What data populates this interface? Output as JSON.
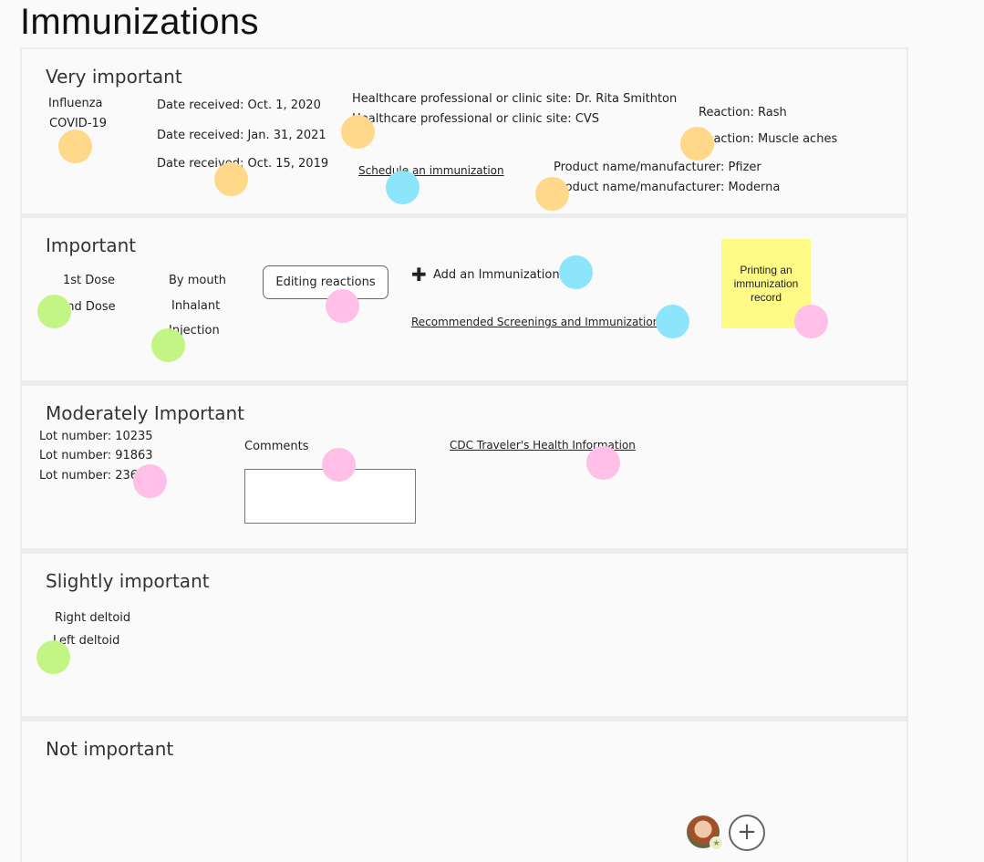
{
  "page": {
    "title": "Immunizations"
  },
  "sections": {
    "very_important": {
      "title": "Very important",
      "vaccine_1": "Influenza",
      "vaccine_2": "COVID-19",
      "date_1": "Date received: Oct. 1, 2020",
      "date_2": "Date received: Jan. 31, 2021",
      "date_3": "Date received: Oct. 15, 2019",
      "site_1": "Healthcare professional or clinic site: Dr. Rita Smithton",
      "site_2": "Healthcare professional or clinic site: CVS",
      "schedule_link": "Schedule an immunization",
      "reaction_1": "Reaction: Rash",
      "reaction_2": "Reaction: Muscle aches",
      "product_1": "Product name/manufacturer: Pfizer",
      "product_2": "Product name/manufacturer: Moderna"
    },
    "important": {
      "title": "Important",
      "dose_1": "1st Dose",
      "dose_2": "2nd Dose",
      "route_1": "By mouth",
      "route_2": "Inhalant",
      "route_3": "Injection",
      "editing_button": "Editing reactions",
      "add_label": "Add an Immunization",
      "recommended_link": "Recommended Screenings and Immunization",
      "sticky_note": "Printing an immunization record"
    },
    "moderately_important": {
      "title": "Moderately Important",
      "lot_1": "Lot number: 10235",
      "lot_2": "Lot number: 91863",
      "lot_3": "Lot number: 236",
      "comments_label": "Comments",
      "cdc_link": "CDC Traveler's Health Information"
    },
    "slightly_important": {
      "title": "Slightly important",
      "site_1": "Right deltoid",
      "site_2": "Left deltoid"
    },
    "not_important": {
      "title": "Not important"
    }
  },
  "icons": {
    "plus": "plus-icon",
    "add_collaborator": "add-circle-icon",
    "avatar_badge": "star-icon"
  },
  "colors": {
    "orange_dot": "#ffd88a",
    "blue_dot": "#8ce5fb",
    "pink_dot": "#ffbfe6",
    "green_dot": "#c2f584",
    "sticky": "#fdfb85"
  }
}
